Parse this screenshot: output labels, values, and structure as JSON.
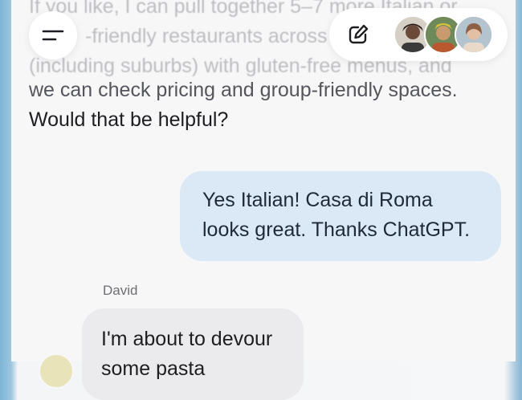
{
  "conversation": {
    "faded_lines": [
      "If you like, I can pull together 5–7 more Italian or",
      "-friendly restaurants across",
      "(including suburbs) with gluten-free menus, and"
    ],
    "assistant_line_1": "we can check pricing and group-friendly spaces.",
    "assistant_line_2": "Would that be helpful?",
    "user_message": "Yes Italian! Casa di Roma looks great. Thanks ChatGPT.",
    "other_sender_name": "David",
    "other_message": "I'm about to devour some pasta"
  },
  "header": {
    "menu_icon": "menu-icon",
    "edit_icon": "edit-icon",
    "participants": [
      {
        "icon": "avatar-person-1",
        "color": "#6b4a3a"
      },
      {
        "icon": "avatar-person-2",
        "color": "#c9b23a"
      },
      {
        "icon": "avatar-person-3",
        "color": "#b98e77"
      }
    ]
  }
}
